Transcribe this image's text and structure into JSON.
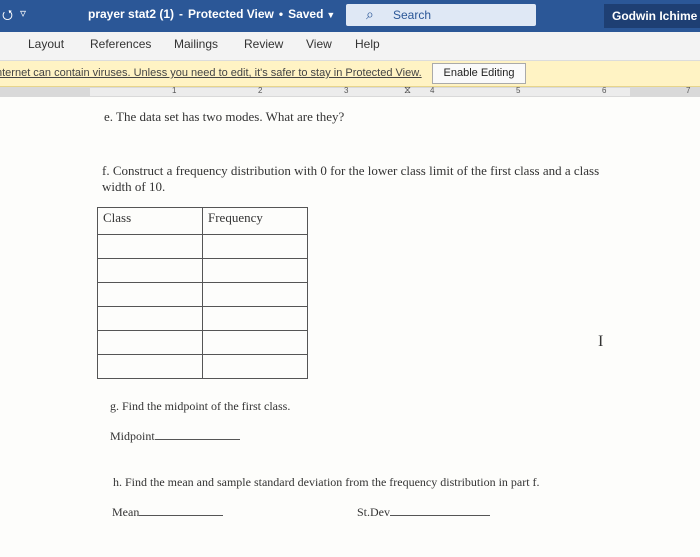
{
  "titlebar": {
    "autosave_glyph": "⭯",
    "qa_glyph": "▿",
    "doc_name": "prayer stat2 (1)",
    "protected": "Protected View",
    "saved": "Saved",
    "search_placeholder": "Search",
    "user": "Godwin Ichime"
  },
  "ribbon": {
    "tabs": [
      "Layout",
      "References",
      "Mailings",
      "Review",
      "View",
      "Help"
    ]
  },
  "protected_bar": {
    "message": "nternet can contain viruses. Unless you need to edit, it's safer to stay in Protected View.",
    "button": "Enable Editing"
  },
  "ruler": {
    "numbers": [
      "1",
      "2",
      "3",
      "4",
      "5",
      "6",
      "7"
    ]
  },
  "document": {
    "item_e": "e.  The data set has two modes.  What are they?",
    "item_f": "f.  Construct a frequency distribution with 0 for the lower class limit of the first class and a class width of 10.",
    "table_headers": [
      "Class",
      "Frequency"
    ],
    "table_rows": 6,
    "item_g": "g.  Find the midpoint of the first class.",
    "midpoint_label": "Midpoint",
    "item_h": "h.  Find the mean and sample standard deviation from the frequency distribution in part f.",
    "mean_label": "Mean",
    "stdev_label": "St.Dev"
  },
  "colors": {
    "title_bar": "#2b5797",
    "protected_bar": "#fff3c4"
  }
}
